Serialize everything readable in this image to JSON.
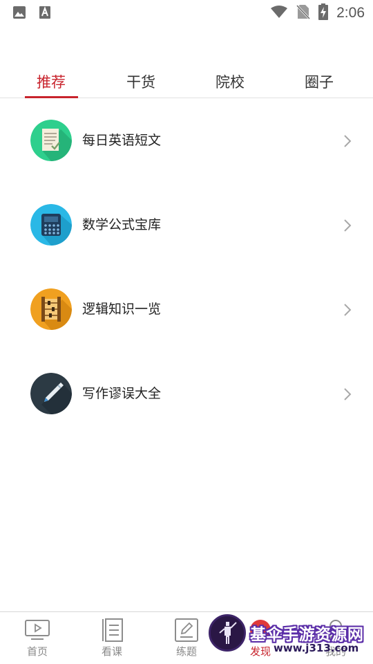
{
  "status_bar": {
    "time": "2:06",
    "left_icons": [
      "image-icon",
      "text-a-icon"
    ],
    "right_icons": [
      "wifi-icon",
      "no-sim-icon",
      "battery-charging-icon"
    ]
  },
  "tabs": [
    {
      "label": "推荐",
      "active": true
    },
    {
      "label": "干货",
      "active": false
    },
    {
      "label": "院校",
      "active": false
    },
    {
      "label": "圈子",
      "active": false
    }
  ],
  "list": [
    {
      "label": "每日英语短文",
      "icon": "document-icon",
      "color": "#2ecf8d"
    },
    {
      "label": "数学公式宝库",
      "icon": "calculator-icon",
      "color": "#2ab8e6"
    },
    {
      "label": "逻辑知识一览",
      "icon": "abacus-icon",
      "color": "#f0a020"
    },
    {
      "label": "写作谬误大全",
      "icon": "pen-icon",
      "color": "#2c3a44"
    }
  ],
  "bottom_nav": [
    {
      "label": "首页",
      "icon": "play-icon",
      "active": false
    },
    {
      "label": "看课",
      "icon": "list-icon",
      "active": false
    },
    {
      "label": "练题",
      "icon": "edit-icon",
      "active": false
    },
    {
      "label": "发现",
      "icon": "discover-icon",
      "active": true
    },
    {
      "label": "我的",
      "icon": "user-icon",
      "active": false
    }
  ],
  "watermark": {
    "title": "基伞手游资源网",
    "url": "www.j313.com"
  },
  "colors": {
    "accent": "#c8232c",
    "text": "#222222",
    "muted": "#888888"
  }
}
